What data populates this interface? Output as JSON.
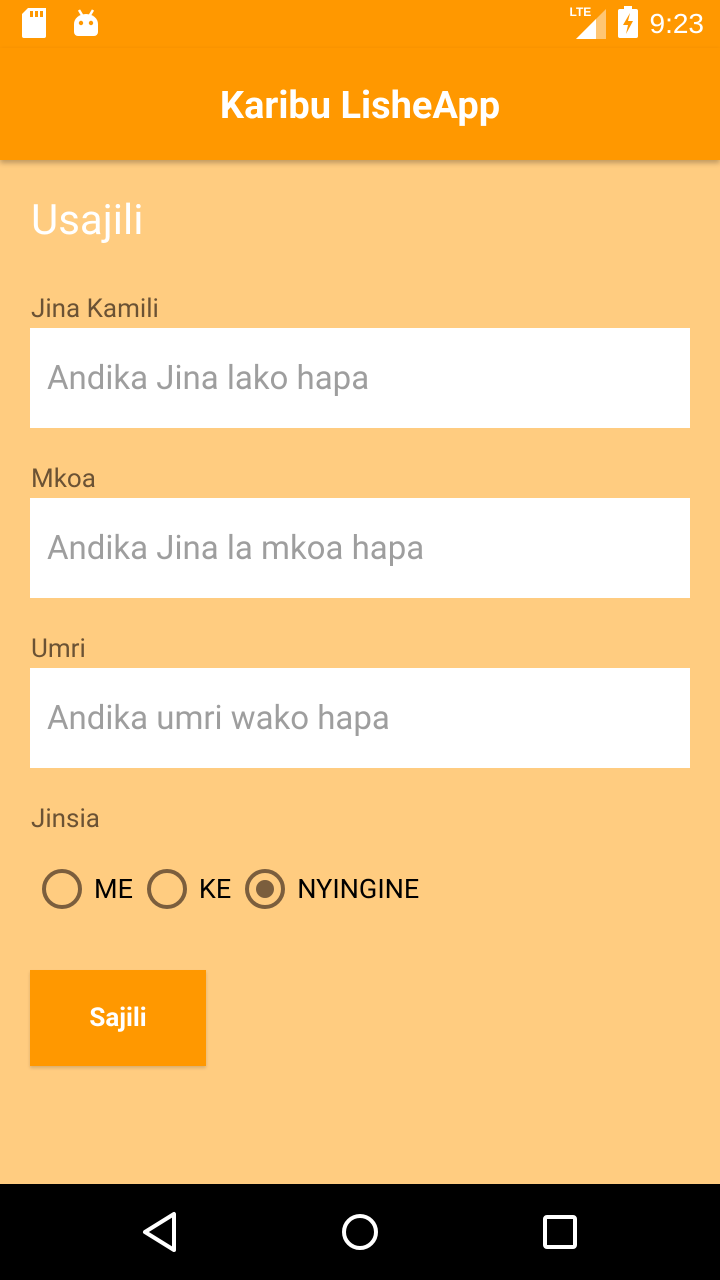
{
  "status_bar": {
    "time": "9:23",
    "network": "LTE",
    "icons": [
      "sd-card-icon",
      "android-icon",
      "signal-icon",
      "battery-charging-icon"
    ]
  },
  "app_bar": {
    "title": "Karibu LisheApp"
  },
  "form": {
    "heading": "Usajili",
    "full_name": {
      "label": "Jina Kamili",
      "placeholder": "Andika Jina lako hapa",
      "value": ""
    },
    "region": {
      "label": "Mkoa",
      "placeholder": "Andika Jina la mkoa hapa",
      "value": ""
    },
    "age": {
      "label": "Umri",
      "placeholder": "Andika umri wako hapa",
      "value": ""
    },
    "gender": {
      "label": "Jinsia",
      "options": [
        "ME",
        "KE",
        "NYINGINE"
      ],
      "selected": "NYINGINE"
    },
    "submit_label": "Sajili"
  },
  "nav_bar": {
    "icons": [
      "back-icon",
      "home-icon",
      "recents-icon"
    ]
  },
  "colors": {
    "primary": "#FF9800",
    "background": "#FFCC80",
    "label_text": "#6b5234",
    "radio": "#7b5e3d"
  }
}
